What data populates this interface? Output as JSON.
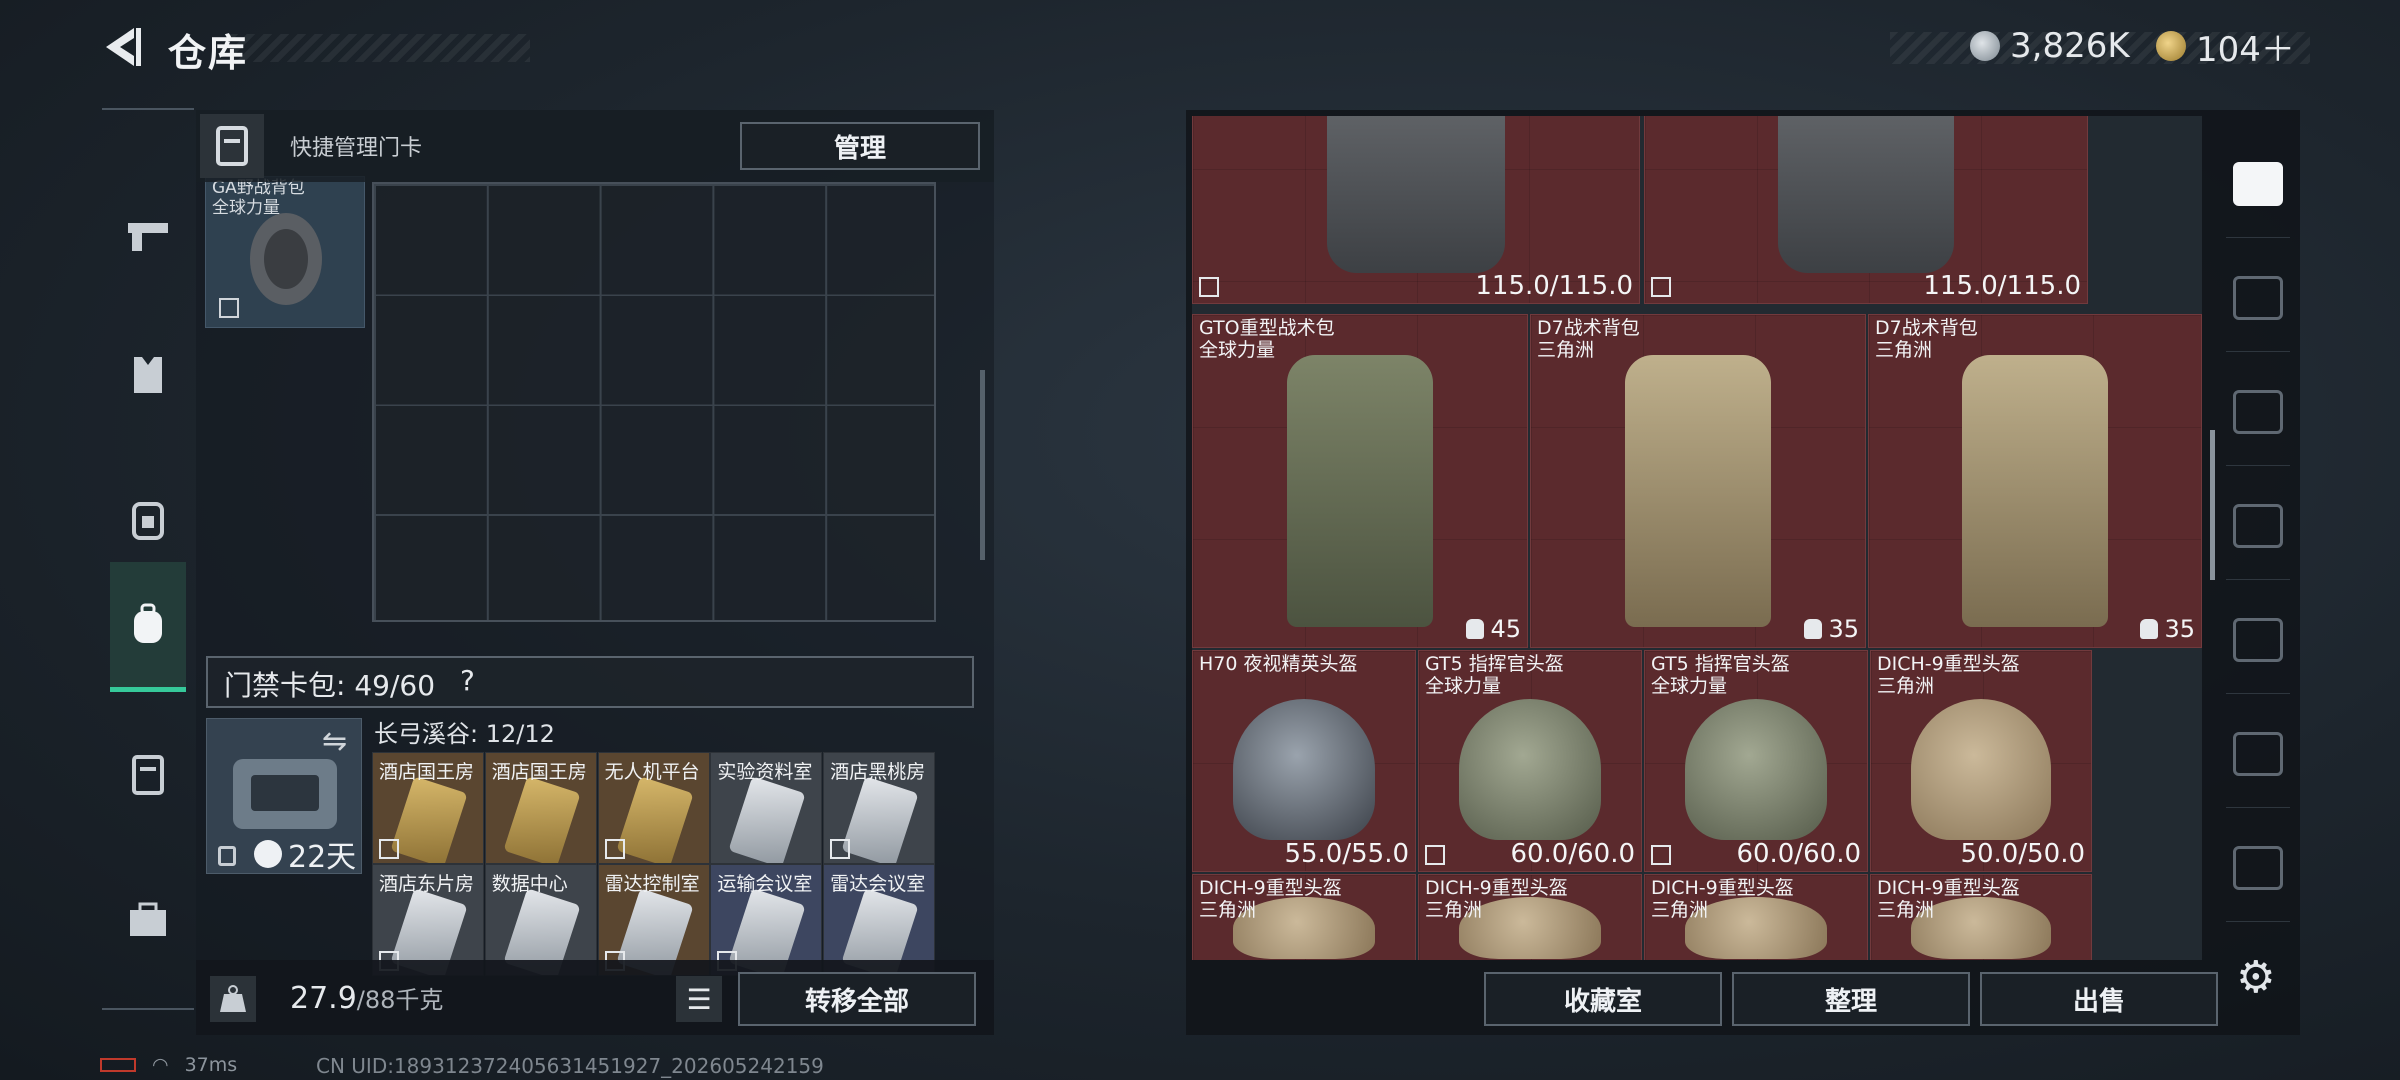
{
  "header": {
    "title": "仓库",
    "silver_amount": "3,826K",
    "gold_amount": "104＋"
  },
  "nav": {
    "items": [
      {
        "name": "weapons",
        "icon": "gun-icon"
      },
      {
        "name": "armor",
        "icon": "vest-icon"
      },
      {
        "name": "chest-rig",
        "icon": "chest-rig-icon"
      },
      {
        "name": "backpack",
        "icon": "backpack-icon",
        "active": true
      },
      {
        "name": "keycard",
        "icon": "keycard-icon"
      },
      {
        "name": "supplies",
        "icon": "toolbox-icon"
      }
    ]
  },
  "left_panel": {
    "quick_label": "快捷管理门卡",
    "manage_label": "管理",
    "bag_name_line1": "GA野战背包",
    "bag_name_line2": "全球力量",
    "card_bag_text": "门禁卡包: 49/60",
    "card_bag_help": "?",
    "card_days": "22天",
    "valley_label": "长弓溪谷: 12/12",
    "cards": [
      {
        "name": "酒店国王房",
        "bg": "brown",
        "img": "gold",
        "nosell": true
      },
      {
        "name": "酒店国王房",
        "bg": "brown",
        "img": "gold",
        "nosell": false
      },
      {
        "name": "无人机平台",
        "bg": "brown",
        "img": "gold",
        "nosell": true
      },
      {
        "name": "实验资料室",
        "bg": "gray",
        "img": "silver",
        "nosell": false
      },
      {
        "name": "酒店黑桃房",
        "bg": "gray",
        "img": "silver",
        "nosell": true
      },
      {
        "name": "酒店东片房",
        "bg": "gray",
        "img": "silver",
        "nosell": true
      },
      {
        "name": "数据中心",
        "bg": "gray",
        "img": "silver",
        "nosell": false
      },
      {
        "name": "雷达控制室",
        "bg": "brown",
        "img": "silver",
        "nosell": true
      },
      {
        "name": "运输会议室",
        "bg": "blue",
        "img": "silver",
        "nosell": true
      },
      {
        "name": "雷达会议室",
        "bg": "blue",
        "img": "silver",
        "nosell": false
      }
    ],
    "weight_value": "27.9",
    "weight_cap": "/88千克",
    "transfer_label": "转移全部"
  },
  "status": {
    "ping": "37ms",
    "uid": "CN UID:189312372405631451927_202605242159"
  },
  "stash": {
    "items": [
      {
        "id": "pouch-1",
        "name1": "",
        "name2": "",
        "durability": "115.0/115.0",
        "cap": "",
        "shape": "pouch",
        "nosell": true
      },
      {
        "id": "pouch-2",
        "name1": "",
        "name2": "",
        "durability": "115.0/115.0",
        "cap": "",
        "shape": "pouch",
        "nosell": true
      },
      {
        "id": "gto",
        "name1": "GTO重型战术包",
        "name2": "全球力量",
        "durability": "",
        "cap": "45",
        "shape": "bp-green",
        "nosell": false
      },
      {
        "id": "d7-1",
        "name1": "D7战术背包",
        "name2": "三角洲",
        "durability": "",
        "cap": "35",
        "shape": "bp-tan",
        "nosell": false
      },
      {
        "id": "d7-2",
        "name1": "D7战术背包",
        "name2": "三角洲",
        "durability": "",
        "cap": "35",
        "shape": "bp-tan",
        "nosell": false
      },
      {
        "id": "h70",
        "name1": "H70 夜视精英头盔",
        "name2": "",
        "durability": "55.0/55.0",
        "cap": "",
        "shape": "hm-dark",
        "nosell": false
      },
      {
        "id": "gt5-1",
        "name1": "GT5 指挥官头盔",
        "name2": "全球力量",
        "durability": "60.0/60.0",
        "cap": "",
        "shape": "hm-green",
        "nosell": true
      },
      {
        "id": "gt5-2",
        "name1": "GT5 指挥官头盔",
        "name2": "全球力量",
        "durability": "60.0/60.0",
        "cap": "",
        "shape": "hm-green",
        "nosell": true
      },
      {
        "id": "dich-1",
        "name1": "DICH-9重型头盔",
        "name2": "三角洲",
        "durability": "50.0/50.0",
        "cap": "",
        "shape": "hm-tan",
        "nosell": false
      },
      {
        "id": "dich-2",
        "name1": "DICH-9重型头盔",
        "name2": "三角洲",
        "durability": "",
        "cap": "",
        "shape": "hm-tan",
        "nosell": false
      },
      {
        "id": "dich-3",
        "name1": "DICH-9重型头盔",
        "name2": "三角洲",
        "durability": "",
        "cap": "",
        "shape": "hm-tan",
        "nosell": false
      },
      {
        "id": "dich-4",
        "name1": "DICH-9重型头盔",
        "name2": "三角洲",
        "durability": "",
        "cap": "",
        "shape": "hm-tan",
        "nosell": false
      },
      {
        "id": "dich-5",
        "name1": "DICH-9重型头盔",
        "name2": "三角洲",
        "durability": "",
        "cap": "",
        "shape": "hm-tan",
        "nosell": false
      }
    ],
    "buttons": {
      "collection": "收藏室",
      "organize": "整理",
      "sell": "出售"
    }
  },
  "right_sidebar": {
    "items": [
      {
        "name": "stash-home",
        "active": true
      },
      {
        "name": "tab-v",
        "active": false
      },
      {
        "name": "tab-iv-add-1",
        "active": false
      },
      {
        "name": "tab-iv-folder",
        "active": false
      },
      {
        "name": "tab-iv-photo",
        "active": false
      },
      {
        "name": "tab-iv-add-2",
        "active": false
      },
      {
        "name": "tab-ii-add",
        "active": false
      }
    ]
  },
  "colors": {
    "accent": "#36c99a",
    "item_bg": "#5b2a2d"
  }
}
